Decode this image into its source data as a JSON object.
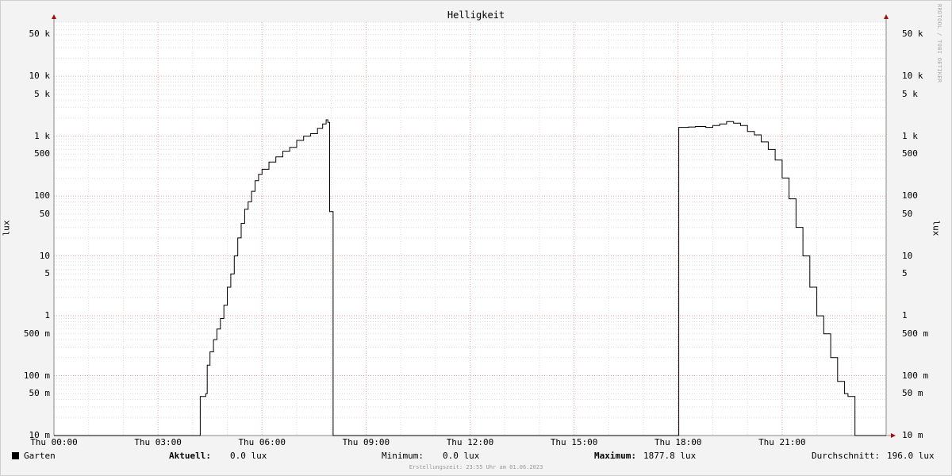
{
  "chart_data": {
    "type": "line",
    "title": "Helligkeit",
    "ylabel": "lux",
    "yscale": "log",
    "ylim": [
      0.01,
      80000
    ],
    "xlim": [
      "Thu 00:00",
      "Thu 24:00"
    ],
    "x_ticks": [
      "Thu 00:00",
      "Thu 03:00",
      "Thu 06:00",
      "Thu 09:00",
      "Thu 12:00",
      "Thu 15:00",
      "Thu 18:00",
      "Thu 21:00"
    ],
    "y_ticks": [
      {
        "value": 50000,
        "label": "50 k"
      },
      {
        "value": 10000,
        "label": "10 k"
      },
      {
        "value": 5000,
        "label": "5 k"
      },
      {
        "value": 1000,
        "label": "1 k"
      },
      {
        "value": 500,
        "label": "500"
      },
      {
        "value": 100,
        "label": "100"
      },
      {
        "value": 50,
        "label": "50"
      },
      {
        "value": 10,
        "label": "10"
      },
      {
        "value": 5,
        "label": "5"
      },
      {
        "value": 1,
        "label": "1"
      },
      {
        "value": 0.5,
        "label": "500 m"
      },
      {
        "value": 0.1,
        "label": "100 m"
      },
      {
        "value": 0.05,
        "label": "50 m"
      },
      {
        "value": 0.01,
        "label": "10 m"
      }
    ],
    "grid": true,
    "series": [
      {
        "name": "Garten",
        "color": "#000000",
        "x": [
          0,
          4.2,
          4.22,
          4.38,
          4.42,
          4.5,
          4.6,
          4.7,
          4.8,
          4.9,
          5.0,
          5.1,
          5.2,
          5.3,
          5.4,
          5.5,
          5.6,
          5.7,
          5.8,
          5.9,
          6.0,
          6.2,
          6.4,
          6.6,
          6.8,
          7.0,
          7.2,
          7.4,
          7.6,
          7.75,
          7.85,
          7.9,
          7.95,
          8.05,
          8.1,
          18.0,
          18.02,
          18.3,
          18.5,
          18.8,
          19.0,
          19.2,
          19.4,
          19.6,
          19.8,
          20.0,
          20.2,
          20.4,
          20.6,
          20.8,
          21.0,
          21.2,
          21.4,
          21.6,
          21.8,
          22.0,
          22.2,
          22.4,
          22.6,
          22.8,
          22.9,
          23.1,
          23.2,
          24.0
        ],
        "y": [
          0.01,
          0.01,
          0.045,
          0.05,
          0.15,
          0.25,
          0.4,
          0.6,
          0.9,
          1.5,
          3,
          5,
          10,
          20,
          35,
          60,
          80,
          120,
          180,
          230,
          280,
          370,
          450,
          560,
          650,
          850,
          1000,
          1100,
          1350,
          1600,
          1878,
          1700,
          55,
          0.01,
          0.01,
          0.01,
          1400,
          1420,
          1450,
          1400,
          1500,
          1600,
          1750,
          1650,
          1500,
          1200,
          1050,
          800,
          600,
          400,
          200,
          90,
          30,
          10,
          3,
          1,
          0.5,
          0.2,
          0.08,
          0.05,
          0.045,
          0.01,
          0.01,
          0.01
        ]
      }
    ]
  },
  "watermark": "RRDTOOL / TOBI OETIKER",
  "legend": {
    "series_name": "Garten",
    "aktuell_label": "Aktuell:",
    "aktuell_value": "0.0 lux",
    "minimum_label": "Minimum:",
    "minimum_value": "0.0 lux",
    "maximum_label": "Maximum:",
    "maximum_value": "1877.8 lux",
    "durchschnitt_label": "Durchschnitt:",
    "durchschnitt_value": "196.0 lux"
  },
  "footer": "Erstellungszeit: 23:55 Uhr am 01.06.2023"
}
